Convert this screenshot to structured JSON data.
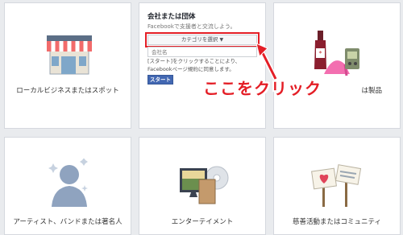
{
  "cards": {
    "local": {
      "label": "ローカルビジネスまたはスポット"
    },
    "company": {
      "title": "会社または団体",
      "subtitle": "Facebookで支援者と交流しよう。",
      "category_select": "カテゴリを選択",
      "name_placeholder": "会社名",
      "terms": "[スタート]をクリックすることにより、Facebookページ規約に同意します。",
      "start_button": "スタート"
    },
    "brand": {
      "label_partial": "は製品"
    },
    "artist": {
      "label": "アーティスト、バンドまたは著名人"
    },
    "entertainment": {
      "label": "エンターテイメント"
    },
    "cause": {
      "label": "慈善活動またはコミュニティ"
    }
  },
  "annotation": {
    "text": "ここをクリック"
  },
  "colors": {
    "highlight": "#e41e26",
    "button": "#4267b2"
  }
}
